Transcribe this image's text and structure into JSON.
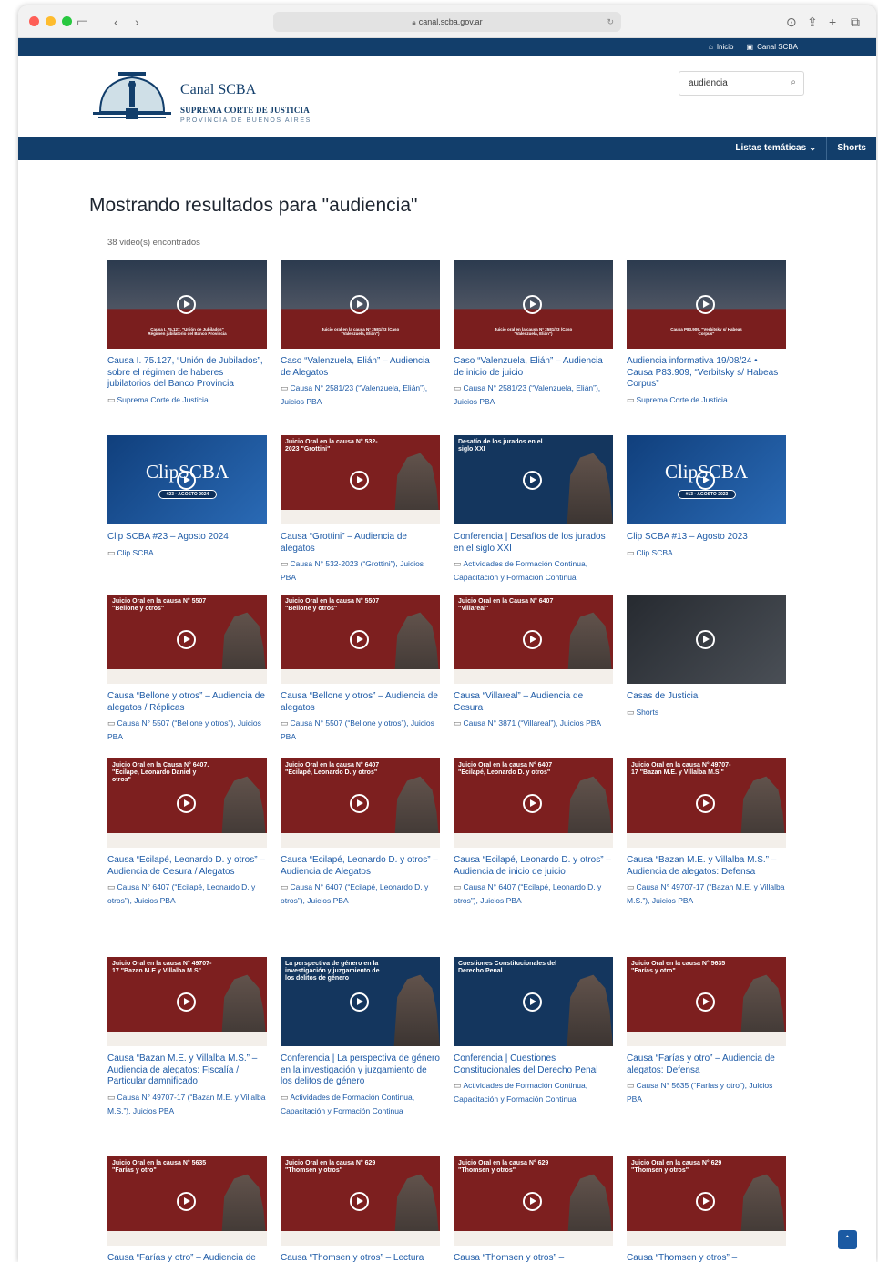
{
  "browser": {
    "url": "canal.scba.gov.ar"
  },
  "topbar": {
    "links": [
      {
        "icon": "home-icon",
        "label": "Inicio"
      },
      {
        "icon": "play-icon",
        "label": "Canal SCBA"
      }
    ]
  },
  "header": {
    "brand_title": "Canal SCBA",
    "brand_subtitle": "SUPREMA CORTE DE JUSTICIA",
    "brand_region": "PROVINCIA DE BUENOS AIRES",
    "search_value": "audiencia"
  },
  "nav": {
    "items": [
      "Listas temáticas ⌄",
      "Shorts"
    ]
  },
  "results": {
    "heading": "Mostrando resultados para \"audiencia\"",
    "count": "38 video(s) encontrados",
    "cards": [
      {
        "thumb_style": "photo",
        "thumb_title": "",
        "thumb_caption": "Causa I. 75.127, \"Unión de Jubilados\" Régimen jubilatorio del Banco Provincia",
        "title": "Causa I. 75.127, “Unión de Jubilados”, sobre el régimen de haberes jubilatorios del Banco Provincia",
        "meta": "Suprema Corte de Justicia"
      },
      {
        "thumb_style": "photo",
        "thumb_title": "",
        "thumb_caption": "Juicio oral en la causa N° 2581/23 (Caso \"Valenzuela, Elián\")",
        "title": "Caso “Valenzuela, Elián” – Audiencia de Alegatos",
        "meta": "Causa N° 2581/23 (“Valenzuela, Elián”), Juicios PBA"
      },
      {
        "thumb_style": "photo",
        "thumb_title": "",
        "thumb_caption": "Juicio oral en la causa N° 2581/23 (Caso \"Valenzuela, Elián\")",
        "title": "Caso “Valenzuela, Elián” – Audiencia de inicio de juicio",
        "meta": "Causa N° 2581/23 (“Valenzuela, Elián”), Juicios PBA"
      },
      {
        "thumb_style": "photo",
        "thumb_title": "",
        "thumb_caption": "Causa P83.909, \"Verbitsky s/ Habeas Corpus\"",
        "title": "Audiencia informativa 19/08/24 • Causa P83.909, “Verbitsky s/ Habeas Corpus”",
        "meta": "Suprema Corte de Justicia"
      },
      {
        "thumb_style": "blue",
        "thumb_title": "",
        "clip": "ClipSCBA",
        "clip_badge": "#23 · AGOSTO 2024",
        "title": "Clip SCBA #23 – Agosto 2024",
        "meta": "Clip SCBA"
      },
      {
        "thumb_style": "red",
        "thumb_title": "Juicio Oral en la causa N° 532-2023 \"Grottini\"",
        "title": "Causa “Grottini” – Audiencia de alegatos",
        "meta": "Causa N° 532-2023 (“Grottini”), Juicios PBA"
      },
      {
        "thumb_style": "navy",
        "thumb_title": "Desafío de los jurados en el siglo XXI",
        "title": "Conferencia | Desafíos de los jurados en el siglo XXI",
        "meta": "Actividades de Formación Continua, Capacitación y Formación Continua"
      },
      {
        "thumb_style": "blue",
        "thumb_title": "",
        "clip": "ClipSCBA",
        "clip_badge": "#13 · AGOSTO 2023",
        "title": "Clip SCBA #13 – Agosto 2023",
        "meta": "Clip SCBA"
      },
      {
        "thumb_style": "red",
        "thumb_title": "Juicio Oral en la causa N° 5507 \"Bellone y otros\"",
        "title": "Causa “Bellone y otros” – Audiencia de alegatos / Réplicas",
        "meta": "Causa N° 5507 (“Bellone y otros”), Juicios PBA"
      },
      {
        "thumb_style": "red",
        "thumb_title": "Juicio Oral en la causa N° 5507 \"Bellone y otros\"",
        "title": "Causa “Bellone y otros” – Audiencia de alegatos",
        "meta": "Causa N° 5507 (“Bellone y otros”), Juicios PBA"
      },
      {
        "thumb_style": "red",
        "thumb_title": "Juicio Oral en la Causa N° 6407 \"Villareal\"",
        "title": "Causa “Villareal” – Audiencia de Cesura",
        "meta": "Causa N° 3871 (“Villareal”), Juicios PBA"
      },
      {
        "thumb_style": "dark",
        "thumb_title": "",
        "title": "Casas de Justicia",
        "meta": "Shorts"
      },
      {
        "thumb_style": "red",
        "thumb_title": "Juicio Oral en la Causa N° 6407. \"Ecilape, Leonardo Daniel y otros\"",
        "title": "Causa “Ecilapé, Leonardo D. y otros” – Audiencia de Cesura / Alegatos",
        "meta": "Causa N° 6407 (“Ecilapé, Leonardo D. y otros”), Juicios PBA"
      },
      {
        "thumb_style": "red",
        "thumb_title": "Juicio Oral en la causa N° 6407 \"Ecilapé, Leonardo D. y otros\"",
        "title": "Causa “Ecilapé, Leonardo D. y otros” – Audiencia de Alegatos",
        "meta": "Causa N° 6407 (“Ecilapé, Leonardo D. y otros”), Juicios PBA"
      },
      {
        "thumb_style": "red",
        "thumb_title": "Juicio Oral en la causa N° 6407 \"Ecilapé, Leonardo D. y otros\"",
        "title": "Causa “Ecilapé, Leonardo D. y otros” – Audiencia de inicio de juicio",
        "meta": "Causa N° 6407 (“Ecilapé, Leonardo D. y otros”), Juicios PBA"
      },
      {
        "thumb_style": "red",
        "thumb_title": "Juicio Oral en la causa N° 49707-17 \"Bazan M.E. y Villalba M.S.\"",
        "title": "Causa “Bazan M.E. y Villalba M.S.” – Audiencia de alegatos: Defensa",
        "meta": "Causa N° 49707-17 (“Bazan M.E. y Villalba M.S.”), Juicios PBA"
      },
      {
        "thumb_style": "red",
        "thumb_title": "Juicio Oral en la causa N° 49707-17 \"Bazan M.E y Villalba M.S\"",
        "title": "Causa “Bazan M.E. y Villalba M.S.” – Audiencia de alegatos: Fiscalía / Particular damnificado",
        "meta": "Causa N° 49707-17 (“Bazan M.E. y Villalba M.S.”), Juicios PBA"
      },
      {
        "thumb_style": "navy",
        "thumb_title": "La perspectiva de género en la investigación y juzgamiento de los delitos de género",
        "title": "Conferencia | La perspectiva de género en la investigación y juzgamiento de los delitos de género",
        "meta": "Actividades de Formación Continua, Capacitación y Formación Continua"
      },
      {
        "thumb_style": "navy",
        "thumb_title": "Cuestiones Constitucionales del Derecho Penal",
        "title": "Conferencia | Cuestiones Constitucionales del Derecho Penal",
        "meta": "Actividades de Formación Continua, Capacitación y Formación Continua"
      },
      {
        "thumb_style": "red",
        "thumb_title": "Juicio Oral en la causa N° 5635 \"Farías y otro\"",
        "title": "Causa “Farías y otro” – Audiencia de alegatos: Defensa",
        "meta": "Causa N° 5635 (“Farías y otro”), Juicios PBA"
      },
      {
        "thumb_style": "red",
        "thumb_title": "Juicio Oral en la causa N° 5635 \"Farías y otro\"",
        "title": "Causa “Farías y otro” – Audiencia de",
        "meta": ""
      },
      {
        "thumb_style": "red",
        "thumb_title": "Juicio Oral en la causa N° 629 \"Thomsen y otros\"",
        "title": "Causa “Thomsen y otros” – Lectura",
        "meta": ""
      },
      {
        "thumb_style": "red",
        "thumb_title": "Juicio Oral en la causa N° 629 \"Thomsen y otros\"",
        "title": "Causa “Thomsen y otros” –",
        "meta": ""
      },
      {
        "thumb_style": "red",
        "thumb_title": "Juicio Oral en la causa N° 629 \"Thomsen y otros\"",
        "title": "Causa “Thomsen y otros” –",
        "meta": ""
      }
    ]
  },
  "colors": {
    "brand_navy": "#123e6b",
    "link_blue": "#1d5aa6",
    "thumb_red": "#7d1f1f"
  }
}
